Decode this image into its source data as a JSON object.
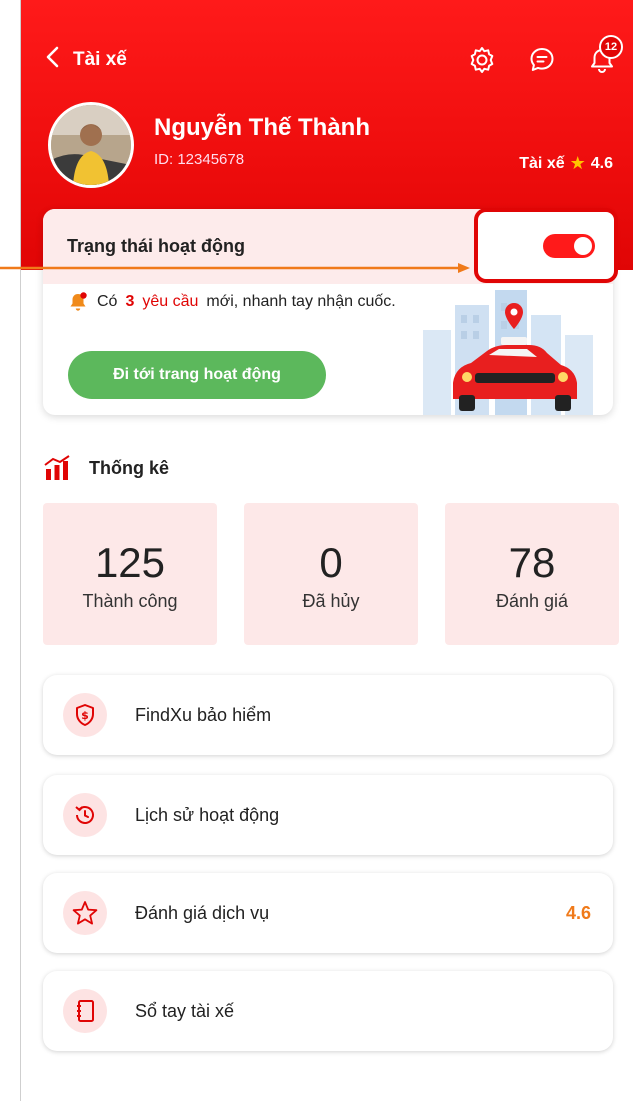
{
  "header": {
    "back_icon": "chevron-left-icon",
    "title": "Tài xế",
    "notification_count": "12",
    "colors": {
      "primary": "#e00505",
      "accent_star": "#ffc400"
    }
  },
  "profile": {
    "name": "Nguyễn Thế Thành",
    "id": "ID: 12345678",
    "role": "Tài xế",
    "rating": "4.6"
  },
  "status_card": {
    "label": "Trạng thái hoạt động",
    "toggle_on": true,
    "notice_prefix": "Có",
    "notice_count": "3",
    "notice_link": "yêu cầu",
    "notice_suffix": "mới, nhanh tay nhận cuốc.",
    "go_button": "Đi tới trang hoạt động"
  },
  "stats": {
    "title": "Thống kê",
    "items": [
      {
        "value": "125",
        "label": "Thành công"
      },
      {
        "value": "0",
        "label": "Đã hủy"
      },
      {
        "value": "78",
        "label": "Đánh giá"
      }
    ]
  },
  "menu": [
    {
      "label": "FindXu bảo hiểm",
      "icon": "shield-dollar-icon",
      "value": ""
    },
    {
      "label": "Lịch sử hoạt động",
      "icon": "history-icon",
      "value": ""
    },
    {
      "label": "Đánh giá dịch vụ",
      "icon": "star-icon",
      "value": "4.6"
    },
    {
      "label": "Sổ tay tài xế",
      "icon": "notebook-icon",
      "value": ""
    }
  ]
}
